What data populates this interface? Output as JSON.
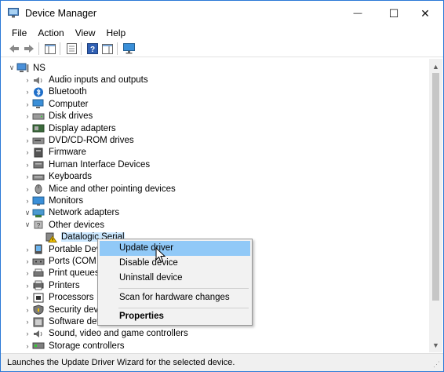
{
  "window": {
    "title": "Device Manager"
  },
  "window_controls": {
    "minimize": "—",
    "maximize": "☐",
    "close": "✕"
  },
  "menu": [
    "File",
    "Action",
    "View",
    "Help"
  ],
  "tree": {
    "root": "NS",
    "items": [
      {
        "label": "Audio inputs and outputs",
        "icon": "speaker-icon",
        "expanded": false
      },
      {
        "label": "Bluetooth",
        "icon": "bluetooth-icon",
        "expanded": false
      },
      {
        "label": "Computer",
        "icon": "computer-icon",
        "expanded": false
      },
      {
        "label": "Disk drives",
        "icon": "disk-drive-icon",
        "expanded": false
      },
      {
        "label": "Display adapters",
        "icon": "display-adapter-icon",
        "expanded": false
      },
      {
        "label": "DVD/CD-ROM drives",
        "icon": "dvd-drive-icon",
        "expanded": false
      },
      {
        "label": "Firmware",
        "icon": "firmware-icon",
        "expanded": false
      },
      {
        "label": "Human Interface Devices",
        "icon": "hid-icon",
        "expanded": false
      },
      {
        "label": "Keyboards",
        "icon": "keyboard-icon",
        "expanded": false
      },
      {
        "label": "Mice and other pointing devices",
        "icon": "mouse-icon",
        "expanded": false
      },
      {
        "label": "Monitors",
        "icon": "monitor-icon",
        "expanded": false
      },
      {
        "label": "Network adapters",
        "icon": "network-adapter-icon",
        "expanded": true
      },
      {
        "label": "Other devices",
        "icon": "other-devices-icon",
        "expanded": true
      },
      {
        "label": "Datalogic Serial",
        "icon": "warning-device-icon",
        "child": true,
        "selected": true
      },
      {
        "label": "Portable Devices",
        "icon": "portable-device-icon",
        "expanded": false
      },
      {
        "label": "Ports (COM & LPT)",
        "icon": "port-icon",
        "expanded": false
      },
      {
        "label": "Print queues",
        "icon": "print-queue-icon",
        "expanded": false
      },
      {
        "label": "Printers",
        "icon": "printer-icon",
        "expanded": false
      },
      {
        "label": "Processors",
        "icon": "processor-icon",
        "expanded": false
      },
      {
        "label": "Security devices",
        "icon": "security-device-icon",
        "expanded": false
      },
      {
        "label": "Software devices",
        "icon": "software-device-icon",
        "expanded": false
      },
      {
        "label": "Sound, video and game controllers",
        "icon": "sound-controller-icon",
        "expanded": false
      },
      {
        "label": "Storage controllers",
        "icon": "storage-controller-icon",
        "expanded": false
      }
    ]
  },
  "context_menu": {
    "update_driver": "Update driver",
    "disable_device": "Disable device",
    "uninstall_device": "Uninstall device",
    "scan_hardware": "Scan for hardware changes",
    "properties": "Properties"
  },
  "status": "Launches the Update Driver Wizard for the selected device.",
  "colors": {
    "accent": "#2b79d6",
    "hover": "#91c9f7",
    "selection": "#cce8ff"
  }
}
